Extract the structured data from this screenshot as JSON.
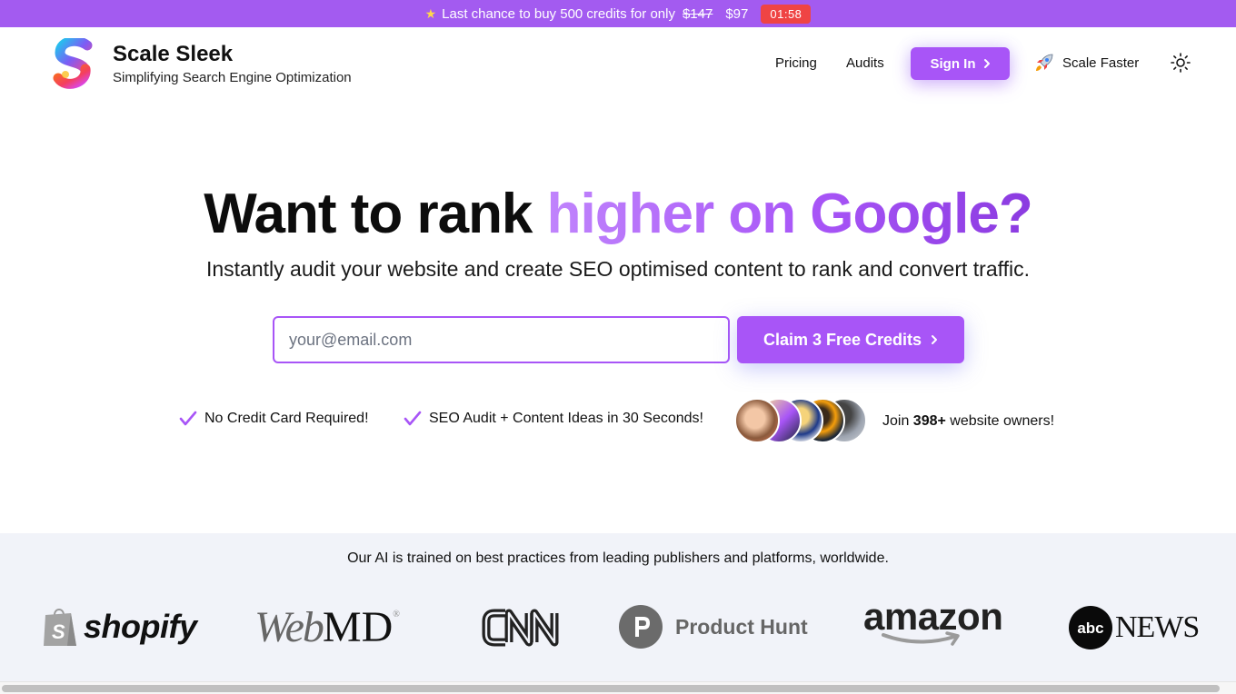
{
  "promo": {
    "icon": "star-icon",
    "text": "Last chance to buy 500 credits for only",
    "old_price": "$147",
    "new_price": "$97",
    "timer": "01:58"
  },
  "header": {
    "brand_title": "Scale Sleek",
    "brand_subtitle": "Simplifying Search Engine Optimization",
    "nav": {
      "pricing": "Pricing",
      "audits": "Audits",
      "sign_in": "Sign In",
      "scale_faster": "Scale Faster"
    }
  },
  "hero": {
    "title_plain": "Want to rank ",
    "title_highlight": "higher on Google?",
    "subtitle": "Instantly audit your website and create SEO optimised content to rank and convert traffic.",
    "email_placeholder": "your@email.com",
    "email_value": "",
    "cta_label": "Claim 3 Free Credits",
    "features": [
      "No Credit Card Required!",
      "SEO Audit + Content Ideas in 30 Seconds!"
    ],
    "join_prefix": "Join ",
    "join_count": "398+",
    "join_suffix": " website owners!"
  },
  "publishers": {
    "heading": "Our AI is trained on best practices from leading publishers and platforms, worldwide.",
    "logos": {
      "shopify": "shopify",
      "webmd_web": "Web",
      "webmd_md": "MD",
      "cnn": "CNN",
      "producthunt_letter": "P",
      "producthunt": "Product Hunt",
      "amazon": "amazon",
      "abc": "abc",
      "news": "NEWS"
    }
  },
  "colors": {
    "accent": "#a855f7",
    "promo_bg": "#a35bf0",
    "timer_bg": "#ef4444",
    "band_bg": "#f1f3f9"
  }
}
